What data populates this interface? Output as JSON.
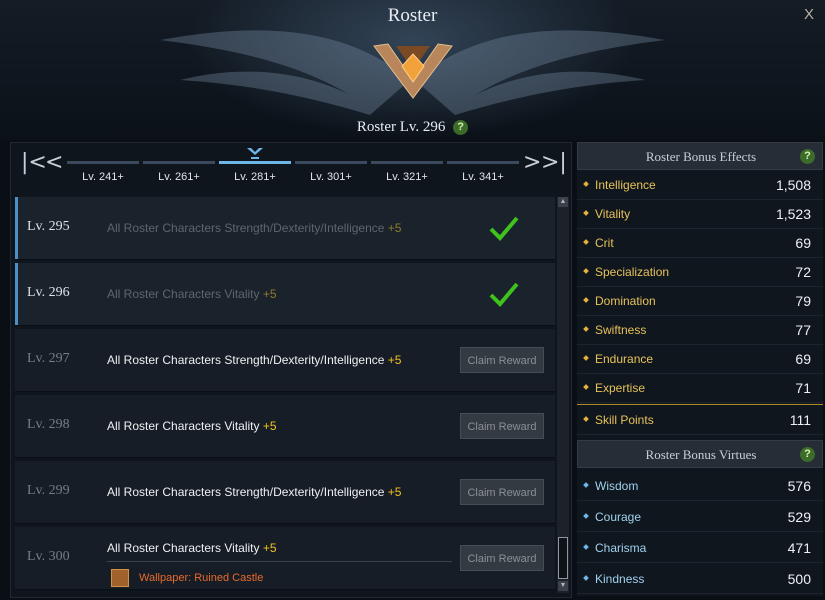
{
  "window": {
    "title": "Roster",
    "close_label": "X",
    "roster_level": "Roster Lv. 296",
    "help_glyph": "?"
  },
  "level_tabs": {
    "first_glyph": "|<",
    "prev_glyph": "<",
    "next_glyph": ">",
    "last_glyph": ">|",
    "tabs": [
      {
        "label": "Lv. 241+"
      },
      {
        "label": "Lv. 261+"
      },
      {
        "label": "Lv. 281+"
      },
      {
        "label": "Lv. 301+"
      },
      {
        "label": "Lv. 321+"
      },
      {
        "label": "Lv. 341+"
      }
    ],
    "active_index": 2
  },
  "rewards": [
    {
      "level": "Lv. 295",
      "description": "All Roster Characters Strength/Dexterity/Intelligence",
      "bonus": "+5",
      "status": "claimed"
    },
    {
      "level": "Lv. 296",
      "description": "All Roster Characters Vitality",
      "bonus": "+5",
      "status": "claimed"
    },
    {
      "level": "Lv. 297",
      "description": "All Roster Characters Strength/Dexterity/Intelligence",
      "bonus": "+5",
      "status": "locked",
      "button": "Claim Reward"
    },
    {
      "level": "Lv. 298",
      "description": "All Roster Characters Vitality",
      "bonus": "+5",
      "status": "locked",
      "button": "Claim Reward"
    },
    {
      "level": "Lv. 299",
      "description": "All Roster Characters Strength/Dexterity/Intelligence",
      "bonus": "+5",
      "status": "locked",
      "button": "Claim Reward"
    },
    {
      "level": "Lv. 300",
      "description": "All Roster Characters Vitality",
      "bonus": "+5",
      "status": "locked",
      "button": "Claim Reward",
      "extra_reward": "Wallpaper: Ruined Castle"
    }
  ],
  "bonus_effects": {
    "title": "Roster Bonus Effects",
    "stats": [
      {
        "name": "Intelligence",
        "value": "1,508"
      },
      {
        "name": "Vitality",
        "value": "1,523"
      },
      {
        "name": "Crit",
        "value": "69"
      },
      {
        "name": "Specialization",
        "value": "72"
      },
      {
        "name": "Domination",
        "value": "79"
      },
      {
        "name": "Swiftness",
        "value": "77"
      },
      {
        "name": "Endurance",
        "value": "69"
      },
      {
        "name": "Expertise",
        "value": "71"
      },
      {
        "name": "Skill Points",
        "value": "111"
      }
    ]
  },
  "bonus_virtues": {
    "title": "Roster Bonus Virtues",
    "stats": [
      {
        "name": "Wisdom",
        "value": "576"
      },
      {
        "name": "Courage",
        "value": "529"
      },
      {
        "name": "Charisma",
        "value": "471"
      },
      {
        "name": "Kindness",
        "value": "500"
      }
    ]
  },
  "colors": {
    "accent_blue": "#6fb6e8",
    "bonus_yellow": "#f2c21b",
    "stat_gold": "#e7c25a",
    "check_green": "#3fc21c",
    "wallpaper_orange": "#e96a2a"
  }
}
